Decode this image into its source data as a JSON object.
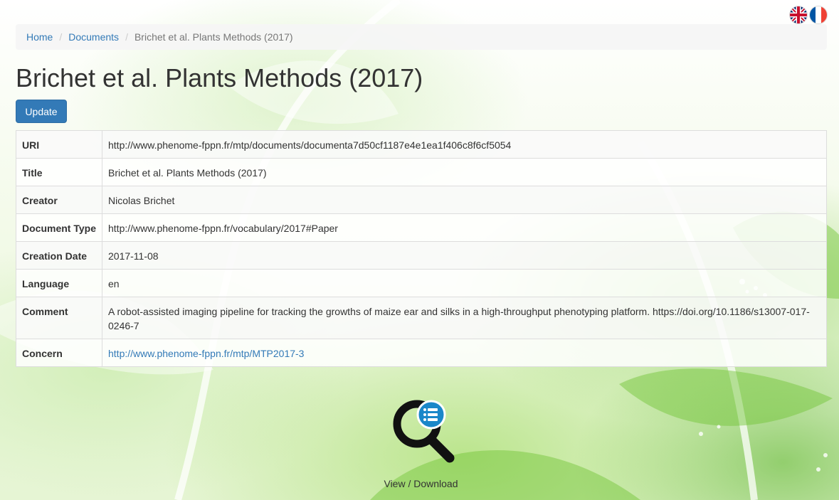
{
  "flags": [
    {
      "lang": "en",
      "icon": "uk-flag-icon"
    },
    {
      "lang": "fr",
      "icon": "france-flag-icon"
    }
  ],
  "breadcrumb": {
    "items": [
      "Home",
      "Documents"
    ],
    "active": "Brichet et al. Plants Methods (2017)"
  },
  "page": {
    "title": "Brichet et al. Plants Methods (2017)",
    "update_label": "Update"
  },
  "details": {
    "uri": {
      "label": "URI",
      "value": "http://www.phenome-fppn.fr/mtp/documents/documenta7d50cf1187e4e1ea1f406c8f6cf5054"
    },
    "title": {
      "label": "Title",
      "value": "Brichet et al. Plants Methods (2017)"
    },
    "creator": {
      "label": "Creator",
      "value": "Nicolas Brichet"
    },
    "document_type": {
      "label": "Document Type",
      "value": "http://www.phenome-fppn.fr/vocabulary/2017#Paper"
    },
    "creation_date": {
      "label": "Creation Date",
      "value": "2017-11-08"
    },
    "language": {
      "label": "Language",
      "value": "en"
    },
    "comment": {
      "label": "Comment",
      "value": "A robot-assisted imaging pipeline for tracking the growths of maize ear and silks in a high-throughput phenotyping platform. https://doi.org/10.1186/s13007-017-0246-7"
    },
    "concern": {
      "label": "Concern",
      "value": "http://www.phenome-fppn.fr/mtp/MTP2017-3"
    }
  },
  "viewer": {
    "icon": "magnifier-list-icon",
    "label": "View / Download"
  },
  "colors": {
    "link": "#337ab7",
    "button": "#337ab7",
    "viewer_badge": "#1a87c9"
  }
}
